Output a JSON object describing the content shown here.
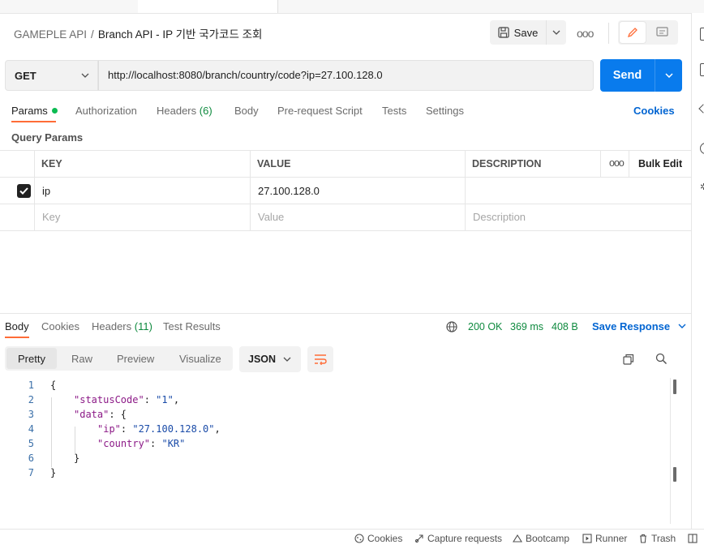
{
  "breadcrumb": {
    "parent": "GAMEPLE API",
    "separator": "/",
    "current": "Branch API - IP 기반 국가코드 조회"
  },
  "toolbar": {
    "save_label": "Save",
    "more_label": "ooo"
  },
  "request": {
    "method": "GET",
    "url": "http://localhost:8080/branch/country/code?ip=27.100.128.0",
    "send_label": "Send"
  },
  "request_tabs": {
    "params": "Params",
    "authorization": "Authorization",
    "headers": "Headers",
    "headers_count": "(6)",
    "body": "Body",
    "prerequest": "Pre-request Script",
    "tests": "Tests",
    "settings": "Settings",
    "cookies": "Cookies"
  },
  "query_params": {
    "title": "Query Params",
    "columns": {
      "key": "KEY",
      "value": "VALUE",
      "description": "DESCRIPTION",
      "more": "ooo",
      "bulk_edit": "Bulk Edit"
    },
    "rows": [
      {
        "checked": true,
        "key": "ip",
        "value": "27.100.128.0",
        "description": ""
      }
    ],
    "placeholders": {
      "key": "Key",
      "value": "Value",
      "description": "Description"
    }
  },
  "response_tabs": {
    "body": "Body",
    "cookies": "Cookies",
    "headers": "Headers",
    "headers_count": "(11)",
    "test_results": "Test Results"
  },
  "response_status": {
    "code": "200 OK",
    "time": "369 ms",
    "size": "408 B",
    "save_response": "Save Response"
  },
  "view_modes": {
    "pretty": "Pretty",
    "raw": "Raw",
    "preview": "Preview",
    "visualize": "Visualize",
    "format": "JSON"
  },
  "code_lines": [
    {
      "n": "1",
      "indent": 0,
      "parts": [
        {
          "t": "{",
          "c": "p"
        }
      ]
    },
    {
      "n": "2",
      "indent": 1,
      "parts": [
        {
          "t": "\"statusCode\"",
          "c": "k"
        },
        {
          "t": ": ",
          "c": "p"
        },
        {
          "t": "\"1\"",
          "c": "s"
        },
        {
          "t": ",",
          "c": "p"
        }
      ]
    },
    {
      "n": "3",
      "indent": 1,
      "parts": [
        {
          "t": "\"data\"",
          "c": "k"
        },
        {
          "t": ": {",
          "c": "p"
        }
      ]
    },
    {
      "n": "4",
      "indent": 2,
      "parts": [
        {
          "t": "\"ip\"",
          "c": "k"
        },
        {
          "t": ": ",
          "c": "p"
        },
        {
          "t": "\"27.100.128.0\"",
          "c": "s"
        },
        {
          "t": ",",
          "c": "p"
        }
      ]
    },
    {
      "n": "5",
      "indent": 2,
      "parts": [
        {
          "t": "\"country\"",
          "c": "k"
        },
        {
          "t": ": ",
          "c": "p"
        },
        {
          "t": "\"KR\"",
          "c": "s"
        }
      ]
    },
    {
      "n": "6",
      "indent": 1,
      "parts": [
        {
          "t": "}",
          "c": "p"
        }
      ]
    },
    {
      "n": "7",
      "indent": 0,
      "parts": [
        {
          "t": "}",
          "c": "p"
        }
      ]
    }
  ],
  "status_bar": {
    "cookies": "Cookies",
    "capture": "Capture requests",
    "bootcamp": "Bootcamp",
    "runner": "Runner",
    "trash": "Trash"
  },
  "colors": {
    "accent": "#ff6c37",
    "send": "#097bed",
    "link": "#0265d2",
    "success": "#0f8a3f"
  }
}
